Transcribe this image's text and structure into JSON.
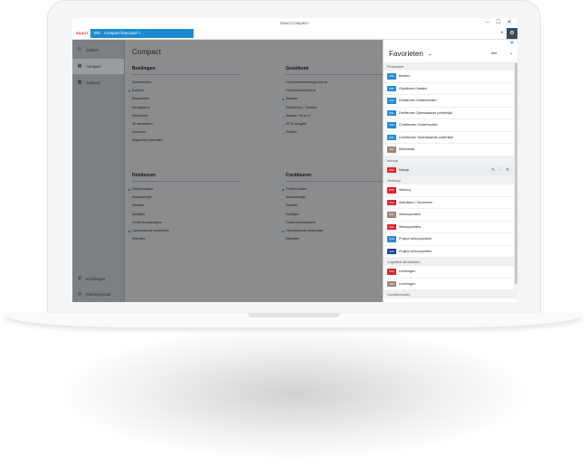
{
  "window": {
    "title": "Exact Compact+"
  },
  "app": {
    "logo_text": "EXACT"
  },
  "tab": {
    "label": "001 · Compact financieel +..."
  },
  "controls": {
    "minimize": "–",
    "maximize": "☐",
    "close": "✕",
    "add": "+",
    "settings": "⚙"
  },
  "sidebar": {
    "items": [
      {
        "label": "Zoeken",
        "icon": "search-icon"
      },
      {
        "label": "Compact",
        "icon": "grid-icon"
      },
      {
        "label": "Systeem",
        "icon": "monitor-icon"
      }
    ],
    "bottom_items": [
      {
        "label": "Instellingen",
        "icon": "gear-icon"
      },
      {
        "label": "Klantenportaal",
        "icon": "globe-icon"
      }
    ]
  },
  "main": {
    "title": "Compact",
    "sections": [
      {
        "heading": "Boekingen",
        "items": [
          {
            "label": "Documenten",
            "mark": ""
          },
          {
            "label": "Boeken",
            "mark": "dot"
          },
          {
            "label": "Beginsaldo",
            "mark": ""
          },
          {
            "label": "Verwijderen",
            "mark": ""
          },
          {
            "label": "Verwerken",
            "mark": ""
          },
          {
            "label": "Te verwerken",
            "mark": ""
          },
          {
            "label": "Verwerkt",
            "mark": ""
          },
          {
            "label": "Afgesloten periodes",
            "mark": ""
          }
        ]
      },
      {
        "heading": "Grootboek",
        "items": [
          {
            "label": "Grootboekrekeningschema",
            "mark": ""
          },
          {
            "label": "Grootboekoverzicht",
            "mark": ""
          },
          {
            "label": "Kaarten",
            "mark": "dot"
          },
          {
            "label": "Selecteren / Zoeken",
            "mark": ""
          },
          {
            "label": "Balans / W en V",
            "mark": "chevron"
          },
          {
            "label": "BTW aangifte",
            "mark": "chevron"
          },
          {
            "label": "Grafiek",
            "mark": "chevron"
          }
        ]
      },
      {
        "heading": "Debiteuren",
        "items": [
          {
            "label": "Onderhouden",
            "mark": "dot"
          },
          {
            "label": "Adressenlijst",
            "mark": ""
          },
          {
            "label": "Kaarten",
            "mark": ""
          },
          {
            "label": "Saldilijst",
            "mark": ""
          },
          {
            "label": "Ouderdomsanalyse",
            "mark": ""
          },
          {
            "label": "Openstaande postenlijst",
            "mark": "dot"
          },
          {
            "label": "Etiketten",
            "mark": ""
          }
        ]
      },
      {
        "heading": "Crediteuren",
        "items": [
          {
            "label": "Onderhouden",
            "mark": "dot"
          },
          {
            "label": "Adressenlijst",
            "mark": ""
          },
          {
            "label": "Kaarten",
            "mark": ""
          },
          {
            "label": "Saldilijst",
            "mark": ""
          },
          {
            "label": "Ouderdomsanalyse",
            "mark": ""
          },
          {
            "label": "Openstaande postenlijst",
            "mark": "dot"
          },
          {
            "label": "Etiketten",
            "mark": ""
          }
        ]
      }
    ]
  },
  "favorites": {
    "title": "Favorieten",
    "filter": "Alle",
    "groups": [
      {
        "name": "Financieel",
        "items": [
          {
            "code": "001",
            "label": "Boeken",
            "color": "#2a8ad4"
          },
          {
            "code": "001",
            "label": "Grootboek Kaarten",
            "color": "#2a8ad4"
          },
          {
            "code": "001",
            "label": "Debiteuren Onderhouden",
            "color": "#2a8ad4"
          },
          {
            "code": "001",
            "label": "Debiteuren Openstaande postenlijst",
            "color": "#2a8ad4"
          },
          {
            "code": "001",
            "label": "Crediteuren Onderhouden",
            "color": "#2a8ad4"
          },
          {
            "code": "001",
            "label": "Crediteuren Openstaande postenlijst",
            "color": "#2a8ad4"
          },
          {
            "code": "002",
            "label": "Memoriaal",
            "color": "#9c8779"
          }
        ]
      },
      {
        "name": "Inkoop",
        "items": [
          {
            "code": "002",
            "label": "Inkoop",
            "color": "#d8262c",
            "highlight": true
          }
        ]
      },
      {
        "name": "Verkoop",
        "items": [
          {
            "code": "002",
            "label": "Verkoop",
            "color": "#d8262c"
          },
          {
            "code": "002",
            "label": "Afdrukken / Verwerken",
            "color": "#d8262c"
          },
          {
            "code": "002",
            "label": "Verkooporders",
            "color": "#9c8779"
          },
          {
            "code": "002",
            "label": "Verkooporders",
            "color": "#d8262c"
          },
          {
            "code": "010",
            "label": "Project verkooporders",
            "color": "#2a8ad4"
          },
          {
            "code": "020",
            "label": "Project verkooporders",
            "color": "#1d3f9c"
          }
        ]
      },
      {
        "name": "Logistiek afhandelen",
        "items": [
          {
            "code": "002",
            "label": "Leveringen",
            "color": "#d8262c"
          },
          {
            "code": "002",
            "label": "Leveringen",
            "color": "#9c8779"
          }
        ]
      },
      {
        "name": "Goederenontv",
        "items": []
      }
    ]
  }
}
